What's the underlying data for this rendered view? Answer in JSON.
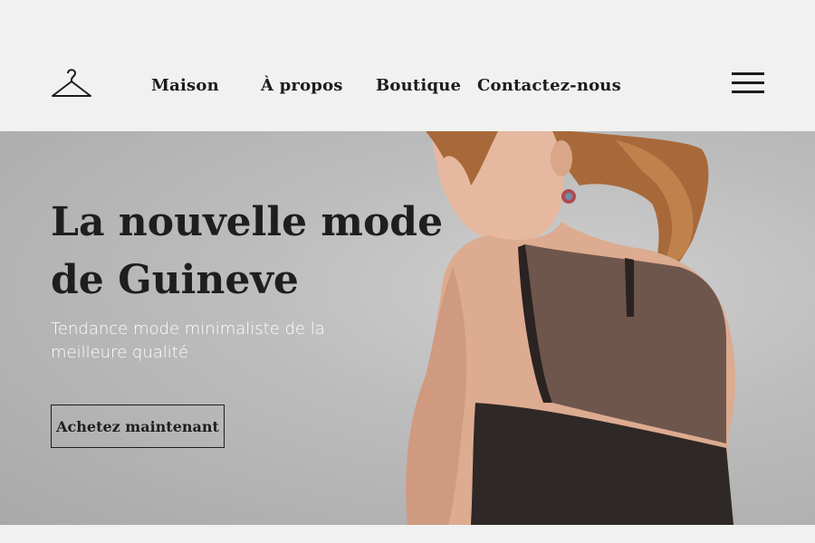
{
  "nav": {
    "items": [
      {
        "label": "Maison"
      },
      {
        "label": "À propos"
      },
      {
        "label": "Boutique"
      },
      {
        "label": "Contactez-nous"
      }
    ]
  },
  "hero": {
    "title": "La nouvelle mode de Guineve",
    "subtitle": "Tendance mode minimaliste de la meilleure qualité",
    "cta_label": "Achetez maintenant"
  },
  "icons": {
    "logo": "clothes-hanger-icon",
    "menu": "hamburger-menu-icon"
  },
  "colors": {
    "background": "#f1f1f1",
    "text": "#1e1e1e",
    "hero_background": "#bdbdbd",
    "subtitle_text": "#ffffff"
  }
}
